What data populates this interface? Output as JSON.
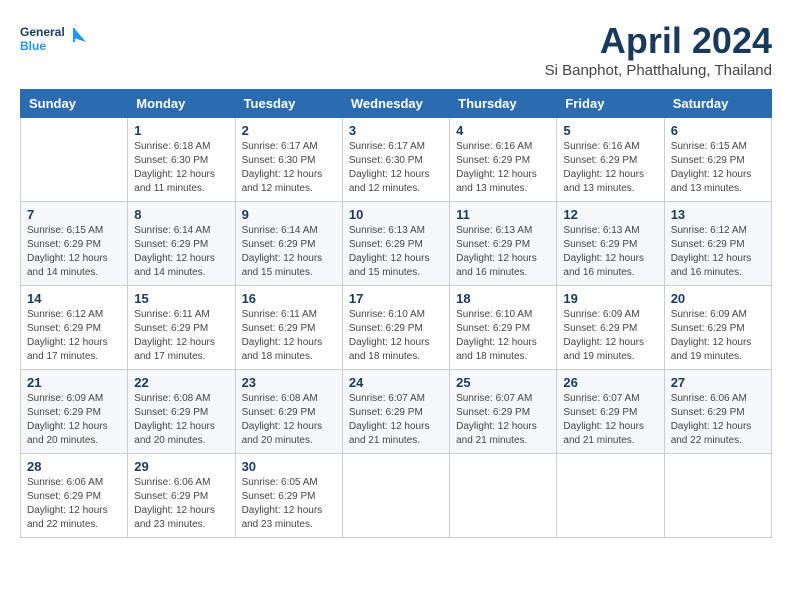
{
  "header": {
    "logo_line1": "General",
    "logo_line2": "Blue",
    "month": "April 2024",
    "location": "Si Banphot, Phatthalung, Thailand"
  },
  "weekdays": [
    "Sunday",
    "Monday",
    "Tuesday",
    "Wednesday",
    "Thursday",
    "Friday",
    "Saturday"
  ],
  "weeks": [
    [
      {
        "day": "",
        "info": ""
      },
      {
        "day": "1",
        "info": "Sunrise: 6:18 AM\nSunset: 6:30 PM\nDaylight: 12 hours\nand 11 minutes."
      },
      {
        "day": "2",
        "info": "Sunrise: 6:17 AM\nSunset: 6:30 PM\nDaylight: 12 hours\nand 12 minutes."
      },
      {
        "day": "3",
        "info": "Sunrise: 6:17 AM\nSunset: 6:30 PM\nDaylight: 12 hours\nand 12 minutes."
      },
      {
        "day": "4",
        "info": "Sunrise: 6:16 AM\nSunset: 6:29 PM\nDaylight: 12 hours\nand 13 minutes."
      },
      {
        "day": "5",
        "info": "Sunrise: 6:16 AM\nSunset: 6:29 PM\nDaylight: 12 hours\nand 13 minutes."
      },
      {
        "day": "6",
        "info": "Sunrise: 6:15 AM\nSunset: 6:29 PM\nDaylight: 12 hours\nand 13 minutes."
      }
    ],
    [
      {
        "day": "7",
        "info": "Sunrise: 6:15 AM\nSunset: 6:29 PM\nDaylight: 12 hours\nand 14 minutes."
      },
      {
        "day": "8",
        "info": "Sunrise: 6:14 AM\nSunset: 6:29 PM\nDaylight: 12 hours\nand 14 minutes."
      },
      {
        "day": "9",
        "info": "Sunrise: 6:14 AM\nSunset: 6:29 PM\nDaylight: 12 hours\nand 15 minutes."
      },
      {
        "day": "10",
        "info": "Sunrise: 6:13 AM\nSunset: 6:29 PM\nDaylight: 12 hours\nand 15 minutes."
      },
      {
        "day": "11",
        "info": "Sunrise: 6:13 AM\nSunset: 6:29 PM\nDaylight: 12 hours\nand 16 minutes."
      },
      {
        "day": "12",
        "info": "Sunrise: 6:13 AM\nSunset: 6:29 PM\nDaylight: 12 hours\nand 16 minutes."
      },
      {
        "day": "13",
        "info": "Sunrise: 6:12 AM\nSunset: 6:29 PM\nDaylight: 12 hours\nand 16 minutes."
      }
    ],
    [
      {
        "day": "14",
        "info": "Sunrise: 6:12 AM\nSunset: 6:29 PM\nDaylight: 12 hours\nand 17 minutes."
      },
      {
        "day": "15",
        "info": "Sunrise: 6:11 AM\nSunset: 6:29 PM\nDaylight: 12 hours\nand 17 minutes."
      },
      {
        "day": "16",
        "info": "Sunrise: 6:11 AM\nSunset: 6:29 PM\nDaylight: 12 hours\nand 18 minutes."
      },
      {
        "day": "17",
        "info": "Sunrise: 6:10 AM\nSunset: 6:29 PM\nDaylight: 12 hours\nand 18 minutes."
      },
      {
        "day": "18",
        "info": "Sunrise: 6:10 AM\nSunset: 6:29 PM\nDaylight: 12 hours\nand 18 minutes."
      },
      {
        "day": "19",
        "info": "Sunrise: 6:09 AM\nSunset: 6:29 PM\nDaylight: 12 hours\nand 19 minutes."
      },
      {
        "day": "20",
        "info": "Sunrise: 6:09 AM\nSunset: 6:29 PM\nDaylight: 12 hours\nand 19 minutes."
      }
    ],
    [
      {
        "day": "21",
        "info": "Sunrise: 6:09 AM\nSunset: 6:29 PM\nDaylight: 12 hours\nand 20 minutes."
      },
      {
        "day": "22",
        "info": "Sunrise: 6:08 AM\nSunset: 6:29 PM\nDaylight: 12 hours\nand 20 minutes."
      },
      {
        "day": "23",
        "info": "Sunrise: 6:08 AM\nSunset: 6:29 PM\nDaylight: 12 hours\nand 20 minutes."
      },
      {
        "day": "24",
        "info": "Sunrise: 6:07 AM\nSunset: 6:29 PM\nDaylight: 12 hours\nand 21 minutes."
      },
      {
        "day": "25",
        "info": "Sunrise: 6:07 AM\nSunset: 6:29 PM\nDaylight: 12 hours\nand 21 minutes."
      },
      {
        "day": "26",
        "info": "Sunrise: 6:07 AM\nSunset: 6:29 PM\nDaylight: 12 hours\nand 21 minutes."
      },
      {
        "day": "27",
        "info": "Sunrise: 6:06 AM\nSunset: 6:29 PM\nDaylight: 12 hours\nand 22 minutes."
      }
    ],
    [
      {
        "day": "28",
        "info": "Sunrise: 6:06 AM\nSunset: 6:29 PM\nDaylight: 12 hours\nand 22 minutes."
      },
      {
        "day": "29",
        "info": "Sunrise: 6:06 AM\nSunset: 6:29 PM\nDaylight: 12 hours\nand 23 minutes."
      },
      {
        "day": "30",
        "info": "Sunrise: 6:05 AM\nSunset: 6:29 PM\nDaylight: 12 hours\nand 23 minutes."
      },
      {
        "day": "",
        "info": ""
      },
      {
        "day": "",
        "info": ""
      },
      {
        "day": "",
        "info": ""
      },
      {
        "day": "",
        "info": ""
      }
    ]
  ]
}
